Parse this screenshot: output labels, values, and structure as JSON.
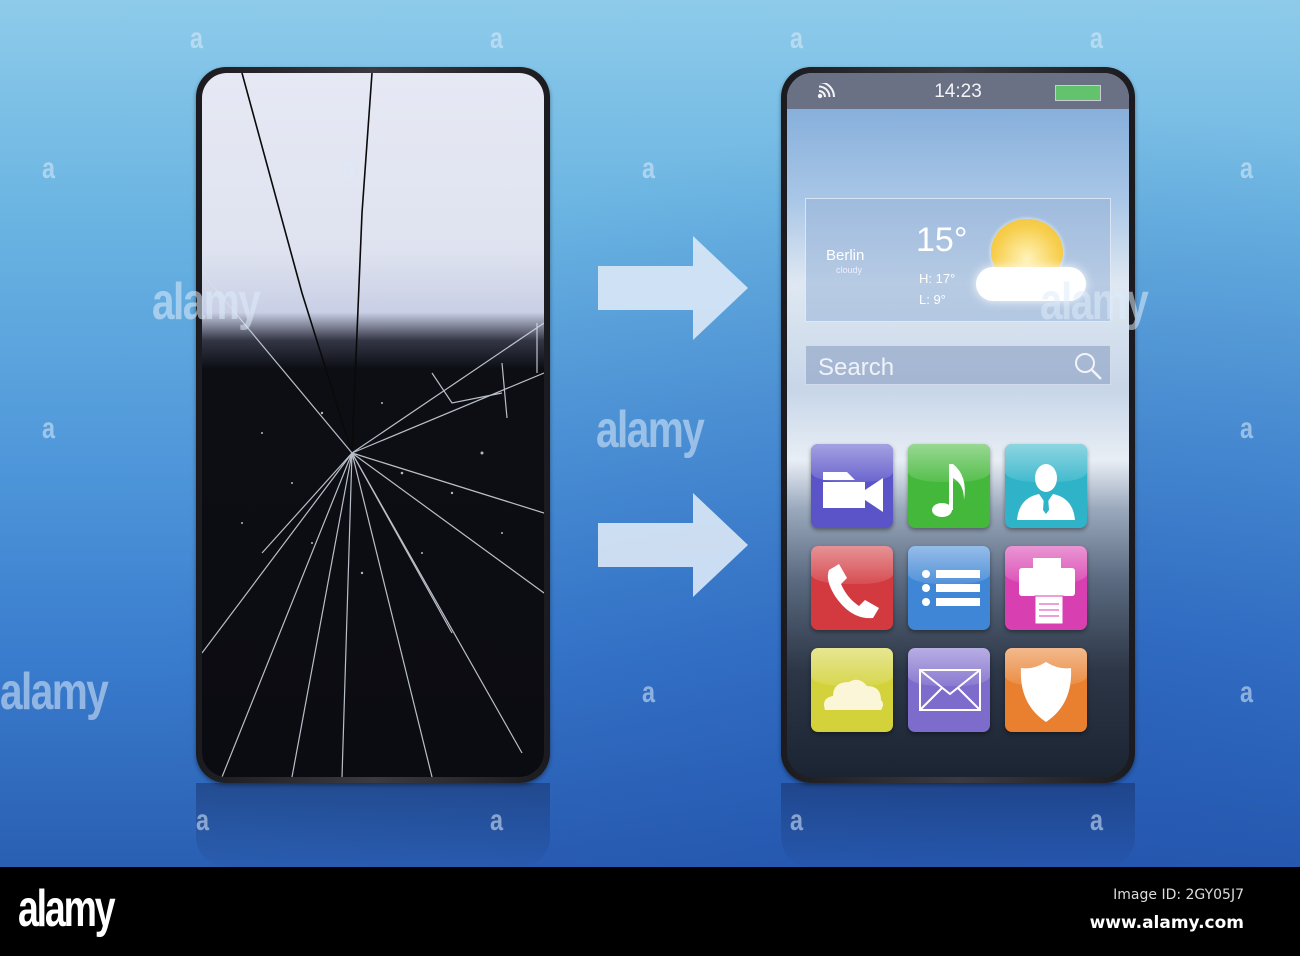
{
  "scene": {
    "background_top": "#8ecbea",
    "background_bottom": "#2a5fb3",
    "arrow_color": "#dce8f6"
  },
  "broken_phone": {
    "state": "cracked screen"
  },
  "arrows": [
    {
      "direction": "right"
    },
    {
      "direction": "right"
    }
  ],
  "repaired_phone": {
    "status_bar": {
      "time": "14:23",
      "wifi_icon": "wifi-icon",
      "battery_icon": "battery-icon",
      "battery_color": "#62c36c"
    },
    "weather": {
      "city": "Berlin",
      "condition": "cloudy",
      "temperature": "15°",
      "high": "H: 17°",
      "low": "L: 9°",
      "icon": "sun-behind-cloud-icon"
    },
    "search": {
      "placeholder": "Search",
      "icon": "search-icon"
    },
    "apps": [
      {
        "name": "video-camera",
        "color": "#5b54c9"
      },
      {
        "name": "music",
        "color": "#44b83a"
      },
      {
        "name": "contacts",
        "color": "#2fb3c9"
      },
      {
        "name": "phone",
        "color": "#d23a3f"
      },
      {
        "name": "list",
        "color": "#3f86d6"
      },
      {
        "name": "printer",
        "color": "#d83fb0"
      },
      {
        "name": "cloud",
        "color": "#d3d23a"
      },
      {
        "name": "mail",
        "color": "#7d6ccc"
      },
      {
        "name": "security-shield",
        "color": "#e8802f"
      }
    ]
  },
  "watermark": {
    "text": "alamy",
    "letter": "a"
  },
  "footer": {
    "logo": "alamy",
    "image_id": "Image ID: 2GY05J7",
    "url": "www.alamy.com"
  }
}
